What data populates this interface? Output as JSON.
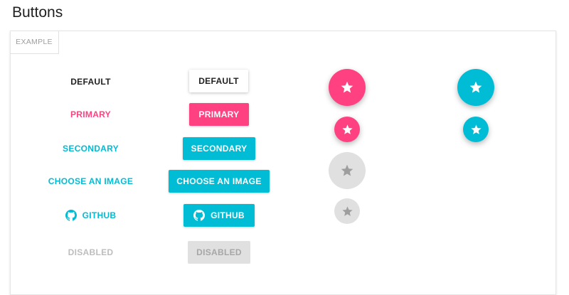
{
  "page": {
    "title": "Buttons"
  },
  "panel": {
    "tab_label": "EXAMPLE"
  },
  "flat_buttons": {
    "default": "DEFAULT",
    "primary": "PRIMARY",
    "secondary": "SECONDARY",
    "choose_image": "CHOOSE AN IMAGE",
    "github": "GITHUB",
    "disabled": "DISABLED"
  },
  "raised_buttons": {
    "default": "DEFAULT",
    "primary": "PRIMARY",
    "secondary": "SECONDARY",
    "choose_image": "CHOOSE AN IMAGE",
    "github": "GITHUB",
    "disabled": "DISABLED"
  },
  "fab_buttons": {
    "icon": "star-icon",
    "items": [
      "pink-large",
      "pink-mini",
      "grey-large-disabled",
      "grey-mini-disabled",
      "cyan-large",
      "cyan-mini"
    ]
  },
  "colors": {
    "primary": "#ff4081",
    "secondary": "#00bcd4",
    "disabled_bg": "#e0e0e0",
    "disabled_text": "#bdbdbd"
  }
}
